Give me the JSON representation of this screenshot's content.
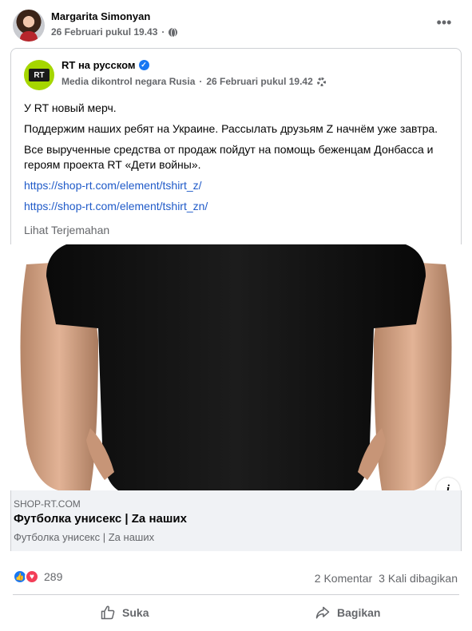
{
  "post": {
    "author": "Margarita Simonyan",
    "timestamp": "26 Februari pukul 19.43",
    "separator": "·",
    "audience_icon": "globe-icon",
    "more_icon": "more-icon",
    "more_glyph": "•••"
  },
  "shared_post": {
    "page_name": "RT на русском",
    "logo_text": "RT",
    "verified_glyph": "✓",
    "meta_label": "Media dikontrol negara Rusia",
    "separator": "·",
    "timestamp": "26 Februari pukul 19.42",
    "lines": [
      "У RT новый мерч.",
      "Поддержим наших ребят на Украине. Рассылать друзьям Z начнём уже завтра.",
      "Все вырученные средства от продаж пойдут на помощь беженцам Донбасса и героям проекта RT «Дети войны»."
    ],
    "links": [
      "https://shop-rt.com/element/tshirt_z/",
      "https://shop-rt.com/element/tshirt_zn/"
    ],
    "translate_label": "Lihat Terjemahan"
  },
  "link_preview": {
    "domain": "SHOP-RT.COM",
    "title": "Футболка унисекс | Za наших",
    "description": "Футболка унисекс | Za наших",
    "info_glyph": "i"
  },
  "engagement": {
    "reaction_count": "289",
    "comments": "2 Komentar",
    "shares": "3 Kali dibagikan",
    "like_glyph": "👍",
    "love_glyph": "♥"
  },
  "actions": {
    "like_label": "Suka",
    "share_label": "Bagikan"
  },
  "colors": {
    "link": "#1f5ac8",
    "muted": "#65676b",
    "like": "#1877f2",
    "love": "#f33e58",
    "rt_green": "#a5d600"
  }
}
